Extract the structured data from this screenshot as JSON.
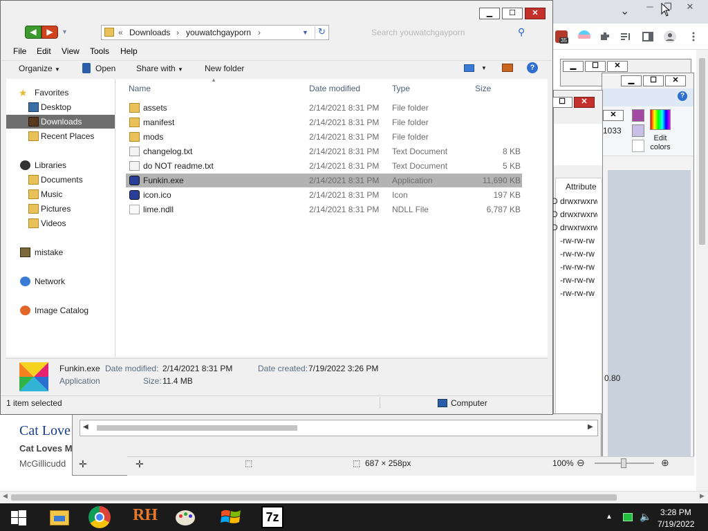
{
  "browser": {
    "window_controls": {
      "minimize": "─",
      "restore": "❐",
      "close": "✕"
    },
    "chevron": "⌄",
    "extension_badge": "35",
    "page_title": "Cat Love",
    "page_subtitle": "Cat Loves M",
    "page_text": "McGillicudd"
  },
  "bg_windows": {
    "paint": {
      "edit_colors_label": "Edit colors",
      "zoom_label": "100%",
      "selection_size": "687 × 258px",
      "field_value": "1033",
      "field_value2": "0.80"
    },
    "attributes_header": "Attribute",
    "attribute_rows": [
      "D drwxrwxrw",
      "D drwxrwxrw",
      "D drwxrwxrw",
      "-rw-rw-rw",
      "-rw-rw-rw",
      "-rw-rw-rw",
      "-rw-rw-rw",
      "-rw-rw-rw"
    ]
  },
  "explorer": {
    "controls": {
      "minimize": "▁",
      "maximize": "☐",
      "close": "✕"
    },
    "address": {
      "chevrons": "«",
      "crumbs": [
        "Downloads",
        "youwatchgayporn"
      ]
    },
    "search_placeholder": "Search youwatchgayporn",
    "menu": [
      "File",
      "Edit",
      "View",
      "Tools",
      "Help"
    ],
    "commands": {
      "organize": "Organize",
      "open": "Open",
      "share_with": "Share with",
      "new_folder": "New folder"
    },
    "nav": {
      "favorites": "Favorites",
      "desktop": "Desktop",
      "downloads": "Downloads",
      "recent": "Recent Places",
      "libraries": "Libraries",
      "documents": "Documents",
      "music": "Music",
      "pictures": "Pictures",
      "videos": "Videos",
      "mistake": "mistake",
      "network": "Network",
      "image_catalog": "Image Catalog"
    },
    "columns": {
      "name": "Name",
      "date": "Date modified",
      "type": "Type",
      "size": "Size"
    },
    "files": [
      {
        "name": "assets",
        "date": "2/14/2021 8:31 PM",
        "type": "File folder",
        "size": "",
        "icon": "folder-icon"
      },
      {
        "name": "manifest",
        "date": "2/14/2021 8:31 PM",
        "type": "File folder",
        "size": "",
        "icon": "folder-icon"
      },
      {
        "name": "mods",
        "date": "2/14/2021 8:31 PM",
        "type": "File folder",
        "size": "",
        "icon": "folder-icon"
      },
      {
        "name": "changelog.txt",
        "date": "2/14/2021 8:31 PM",
        "type": "Text Document",
        "size": "8 KB",
        "icon": "text-file-icon"
      },
      {
        "name": "do NOT readme.txt",
        "date": "2/14/2021 8:31 PM",
        "type": "Text Document",
        "size": "5 KB",
        "icon": "text-file-icon"
      },
      {
        "name": "Funkin.exe",
        "date": "2/14/2021 8:31 PM",
        "type": "Application",
        "size": "11,690 KB",
        "icon": "funkin-app-icon"
      },
      {
        "name": "icon.ico",
        "date": "2/14/2021 8:31 PM",
        "type": "Icon",
        "size": "197 KB",
        "icon": "funkin-app-icon"
      },
      {
        "name": "lime.ndll",
        "date": "2/14/2021 8:31 PM",
        "type": "NDLL File",
        "size": "6,787 KB",
        "icon": "ndll-file-icon"
      }
    ],
    "details": {
      "name": "Funkin.exe",
      "type": "Application",
      "date_modified_label": "Date modified:",
      "date_modified": "2/14/2021 8:31 PM",
      "date_created_label": "Date created:",
      "date_created": "7/19/2022 3:26 PM",
      "size_label": "Size:",
      "size": "11.4 MB"
    },
    "status": {
      "selection": "1 item selected",
      "location": "Computer"
    }
  },
  "taskbar": {
    "time": "3:28 PM",
    "date": "7/19/2022",
    "apps": [
      "start-button",
      "file-explorer-icon",
      "chrome-icon",
      "rh-app-icon",
      "paint-icon",
      "windows-logo-icon",
      "7zip-icon"
    ],
    "seven_zip_label": "7z",
    "rh_label": "RH"
  },
  "colors": {
    "selection": "#b3b3b3",
    "nav_selected": "#6e6e6e",
    "close_red": "#c4302b",
    "taskbar": "#1b1b1b"
  }
}
